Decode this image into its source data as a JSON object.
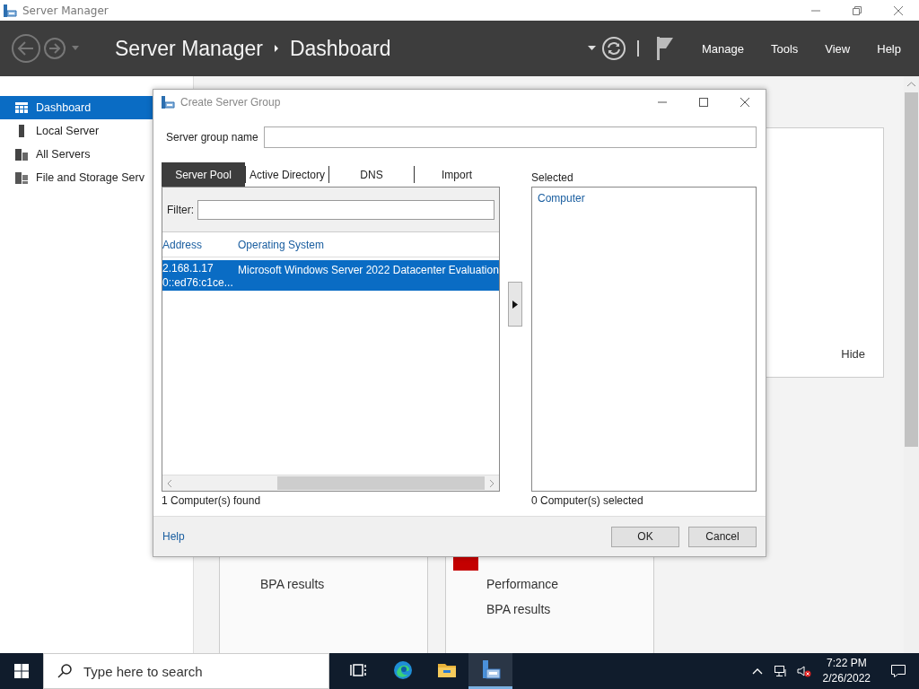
{
  "window": {
    "title": "Server Manager"
  },
  "header": {
    "breadcrumb_root": "Server Manager",
    "breadcrumb_page": "Dashboard",
    "menus": [
      "Manage",
      "Tools",
      "View",
      "Help"
    ]
  },
  "sidebar": {
    "items": [
      {
        "label": "Dashboard",
        "kind": "dashboard",
        "selected": true
      },
      {
        "label": "Local Server",
        "kind": "server",
        "selected": false
      },
      {
        "label": "All Servers",
        "kind": "servers",
        "selected": false
      },
      {
        "label": "File and Storage Serv",
        "kind": "storage",
        "selected": false
      }
    ]
  },
  "background": {
    "panel_action": "Hide",
    "tiles": [
      {
        "items": [
          "BPA results"
        ],
        "alert": false
      },
      {
        "items": [
          "Performance",
          "BPA results"
        ],
        "alert": true
      }
    ]
  },
  "dialog": {
    "title": "Create Server Group",
    "name_label": "Server group name",
    "tabs": [
      {
        "label": "Server Pool",
        "selected": true
      },
      {
        "label": "Active Directory",
        "selected": false
      },
      {
        "label": "DNS",
        "selected": false
      },
      {
        "label": "Import",
        "selected": false
      }
    ],
    "filter_label": "Filter:",
    "columns": [
      "Address",
      "Operating System"
    ],
    "rows": [
      {
        "address": [
          "2.168.1.17",
          "0::ed76:c1ce..."
        ],
        "os": "Microsoft Windows Server 2022 Datacenter Evaluation",
        "selected": true
      }
    ],
    "found": "1 Computer(s) found",
    "selected_label": "Selected",
    "selected_column": "Computer",
    "selected_count": "0 Computer(s) selected",
    "help": "Help",
    "buttons": [
      "OK",
      "Cancel"
    ]
  },
  "taskbar": {
    "search_placeholder": "Type here to search",
    "apps": [
      {
        "kind": "taskview",
        "selected": false
      },
      {
        "kind": "edge",
        "selected": false
      },
      {
        "kind": "folder",
        "selected": false
      },
      {
        "kind": "servermanager",
        "selected": true
      }
    ],
    "time": "7:22 PM",
    "date": "2/26/2022"
  }
}
